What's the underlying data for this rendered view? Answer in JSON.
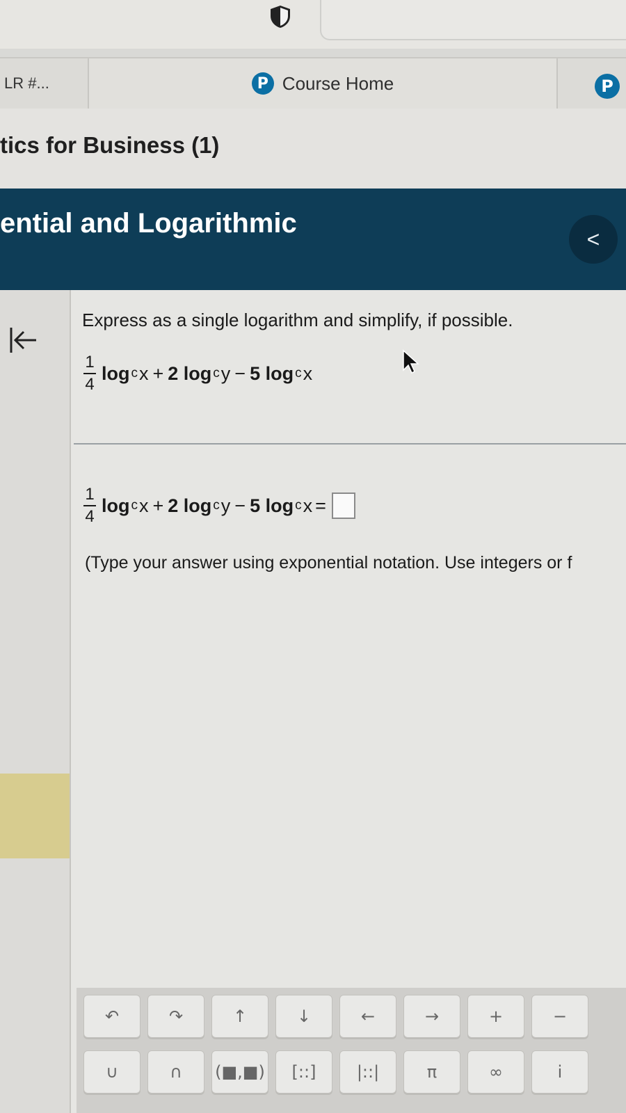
{
  "tabs": {
    "left_label": "LR #...",
    "course_home_label": "Course Home",
    "logo_letter": "P"
  },
  "course": {
    "title": "tics for Business (1)"
  },
  "banner": {
    "title": "ential and Logarithmic",
    "collapse_symbol": "<"
  },
  "question": {
    "prompt": "Express as a single logarithm and simplify, if possible.",
    "frac_num": "1",
    "frac_den": "4",
    "term1_log": "log",
    "term1_base": "c",
    "term1_arg": "x",
    "op1": "+",
    "term2": "2 log",
    "term2_base": "c",
    "term2_arg": "y",
    "op2": "−",
    "term3": "5 log",
    "term3_base": "c",
    "term3_arg": "x",
    "equals": "=",
    "hint": "(Type your answer using exponential notation. Use integers or f"
  },
  "keypad": {
    "row1": [
      "↶",
      "↷",
      "↑",
      "↓",
      "←",
      "→",
      "+",
      "−"
    ],
    "row2": [
      "∪",
      "∩",
      "(■,■)",
      "[::]",
      "|::|",
      "π",
      "∞",
      "i"
    ]
  },
  "colors": {
    "banner": "#0e3d57",
    "pearson_blue": "#0b6fa4",
    "sidebar_highlight": "#d7cc8f"
  }
}
